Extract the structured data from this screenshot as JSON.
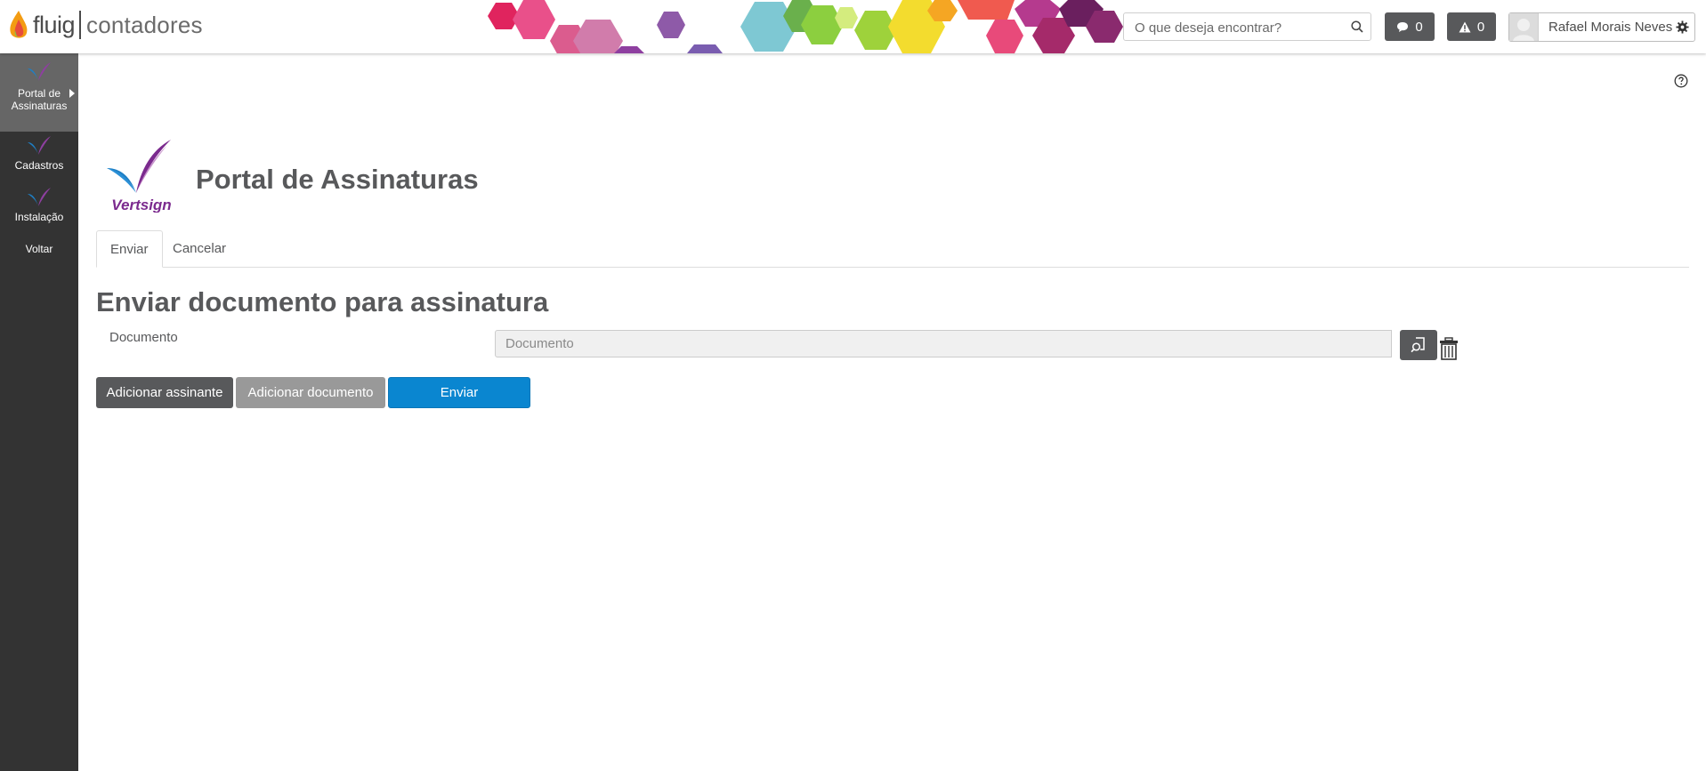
{
  "header": {
    "brand_name": "fluig",
    "product_name": "contadores",
    "search_placeholder": "O que deseja encontrar?",
    "messages_count": "0",
    "alerts_count": "0",
    "user_name": "Rafael Morais Neves"
  },
  "sidebar": {
    "items": [
      {
        "label_line1": "Portal de",
        "label_line2": "Assinaturas",
        "active": true
      },
      {
        "label": "Cadastros"
      },
      {
        "label": "Instalação"
      },
      {
        "label": "Voltar"
      }
    ]
  },
  "main": {
    "logo_text": "Vertsign",
    "page_title": "Portal de Assinaturas",
    "tabs": [
      {
        "label": "Enviar",
        "active": true
      },
      {
        "label": "Cancelar"
      }
    ],
    "section_title": "Enviar documento para assinatura",
    "document_label": "Documento",
    "document_placeholder": "Documento",
    "buttons": {
      "add_signer": "Adicionar assinante",
      "add_document": "Adicionar documento",
      "send": "Enviar"
    }
  },
  "colors": {
    "sidebar_bg": "#333333",
    "sidebar_active": "#666666",
    "dark_button": "#58595b",
    "grey_button": "#999999",
    "primary_button": "#0a86d0",
    "vertsign_blue": "#1f7fc4",
    "vertsign_purple": "#7b2a8e"
  }
}
